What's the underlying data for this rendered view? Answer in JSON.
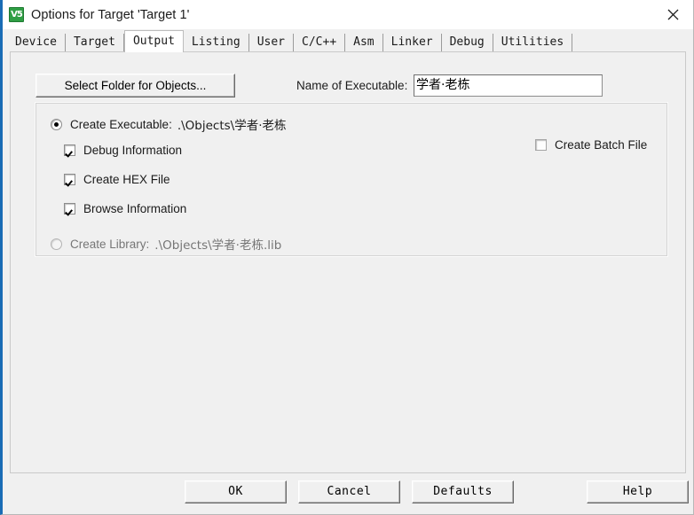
{
  "window": {
    "title": "Options for Target 'Target 1'",
    "icon": "keil-uvision-icon",
    "close_label": "✕",
    "accent_color": "#1a6cb5",
    "face_color": "#f0f0f0"
  },
  "tabs": [
    {
      "label": "Device",
      "active": false
    },
    {
      "label": "Target",
      "active": false
    },
    {
      "label": "Output",
      "active": true
    },
    {
      "label": "Listing",
      "active": false
    },
    {
      "label": "User",
      "active": false
    },
    {
      "label": "C/C++",
      "active": false
    },
    {
      "label": "Asm",
      "active": false
    },
    {
      "label": "Linker",
      "active": false
    },
    {
      "label": "Debug",
      "active": false
    },
    {
      "label": "Utilities",
      "active": false
    }
  ],
  "output": {
    "select_folder_button": "Select Folder for Objects...",
    "executable_name_label": "Name of Executable:",
    "executable_name_value": "学者·老栋",
    "create_executable": {
      "label": "Create Executable:",
      "path": ".\\Objects\\学者·老栋",
      "selected": true
    },
    "debug_information": {
      "label": "Debug Information",
      "checked": true
    },
    "create_hex_file": {
      "label": "Create HEX File",
      "checked": true
    },
    "browse_information": {
      "label": "Browse Information",
      "checked": true
    },
    "create_batch_file": {
      "label": "Create Batch File",
      "checked": false
    },
    "create_library": {
      "label": "Create Library:",
      "path": ".\\Objects\\学者·老栋.lib",
      "selected": false
    }
  },
  "footer": {
    "ok": "OK",
    "cancel": "Cancel",
    "defaults": "Defaults",
    "help": "Help"
  }
}
